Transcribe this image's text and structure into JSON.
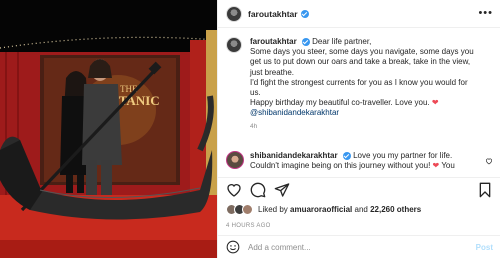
{
  "post": {
    "author": "faroutakhtar",
    "verified": true,
    "more_icon": "more-horizontal-icon"
  },
  "caption": {
    "author": "faroutakhtar",
    "lines": [
      "Dear life partner,",
      "Some days you steer, some days you navigate, some days you",
      "get us to put down our oars and take a break, take in the view,",
      "just breathe.",
      "I'd fight the strongest currents for you as I know you would for",
      "us.",
      "Happy birthday my beautiful co-traveller. Love you. "
    ],
    "heart": "❤",
    "mention": "@shibanidandekarakhtar",
    "time": "4h"
  },
  "reply": {
    "author": "shibanidandekarakhtar",
    "line1": "Love you my partner for life.",
    "line2": "Couldn't imagine being on this journey without you! ",
    "heart": "❤",
    "tail": " You"
  },
  "likes": {
    "prefix": "Liked by ",
    "user": "amuaroraofficial",
    "middle": " and ",
    "count": "22,260 others"
  },
  "timestamp": "4 HOURS AGO",
  "add_comment": {
    "placeholder": "Add a comment...",
    "post_label": "Post"
  },
  "photo": {
    "sign_text": "THE",
    "sign_text2": "TITANIC",
    "colors": {
      "curtain": "#9e1b1b",
      "floor": "#c82a1e",
      "boat": "#2a2a2a"
    }
  },
  "colors": {
    "link": "#00376b",
    "verified": "#3897f0",
    "heart": "#ed4956",
    "post_button": "#b2dffc"
  }
}
